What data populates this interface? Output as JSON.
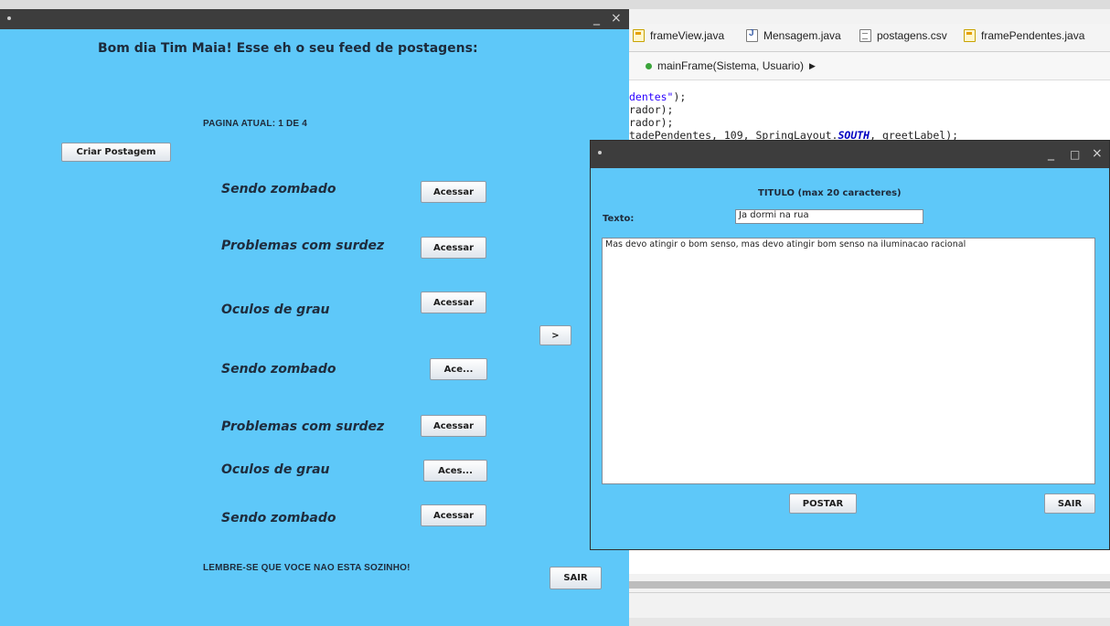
{
  "ide": {
    "tabs": [
      {
        "label": "frameView.java",
        "icon": "form-file-icon"
      },
      {
        "label": "Mensagem.java",
        "icon": "java-file-icon"
      },
      {
        "label": "postagens.csv",
        "icon": "csv-file-icon"
      },
      {
        "label": "framePendentes.java",
        "icon": "form-file-icon"
      }
    ],
    "breadcrumb": "mainFrame(Sistema, Usuario)",
    "code_lines": {
      "line1_str": "dentes\"",
      "line1_rest": ");",
      "line2": "rador);",
      "line3": "rador);",
      "line4_a": "tadePendentes, 109, SpringLayout.",
      "line4_kw": "SOUTH",
      "line4_b": ", greetLabel);"
    }
  },
  "main_window": {
    "title_controls": {
      "minimize": "_",
      "close": "×"
    },
    "greeting": "Bom dia Tim Maia! Esse eh o seu feed de postagens:",
    "page_indicator": "PAGINA ATUAL:  1 DE 4",
    "create_post_label": "Criar Postagem",
    "next_page_label": ">",
    "posts": [
      {
        "title": "Sendo zombado",
        "button": "Acessar"
      },
      {
        "title": "Problemas com surdez",
        "button": "Acessar"
      },
      {
        "title": "Oculos de grau",
        "button": "Acessar"
      },
      {
        "title": "Sendo zombado",
        "button": "Ace..."
      },
      {
        "title": "Problemas com surdez",
        "button": "Acessar"
      },
      {
        "title": "Oculos de grau",
        "button": "Aces..."
      },
      {
        "title": "Sendo zombado",
        "button": "Acessar"
      }
    ],
    "footer_message": "LEMBRE-SE QUE VOCE NAO ESTA SOZINHO!",
    "exit_label": "SAIR"
  },
  "post_window": {
    "title_controls": {
      "minimize": "_",
      "maximize": "□",
      "close": "×"
    },
    "title_label": "TITULO (max 20 caracteres)",
    "text_label": "Texto:",
    "title_value": "Ja dormi na rua",
    "body_value": "Mas devo atingir o bom senso, mas devo atingir bom senso na iluminacao racional",
    "post_label": "POSTAR",
    "exit_label": "SAIR"
  },
  "colors": {
    "window_background": "#5ec8f9",
    "titlebar": "#3d3d3d"
  }
}
